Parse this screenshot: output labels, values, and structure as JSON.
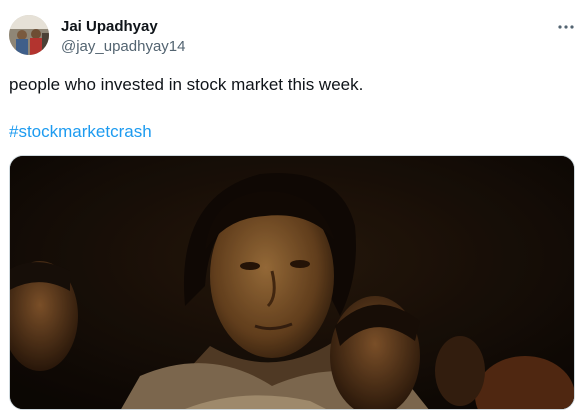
{
  "tweet": {
    "author": {
      "display_name": "Jai Upadhyay",
      "handle": "@jay_upadhyay14",
      "avatar_icon": "profile-photo"
    },
    "more_icon": "more-horizontal-icon",
    "text": "people who invested in stock market this week.",
    "hashtag": "#stockmarketcrash",
    "media": {
      "type": "image",
      "description_icon": "movie-still-image"
    },
    "colors": {
      "text": "#0f1419",
      "secondary": "#536471",
      "link": "#1d9bf0",
      "border": "#cfd9de"
    }
  }
}
